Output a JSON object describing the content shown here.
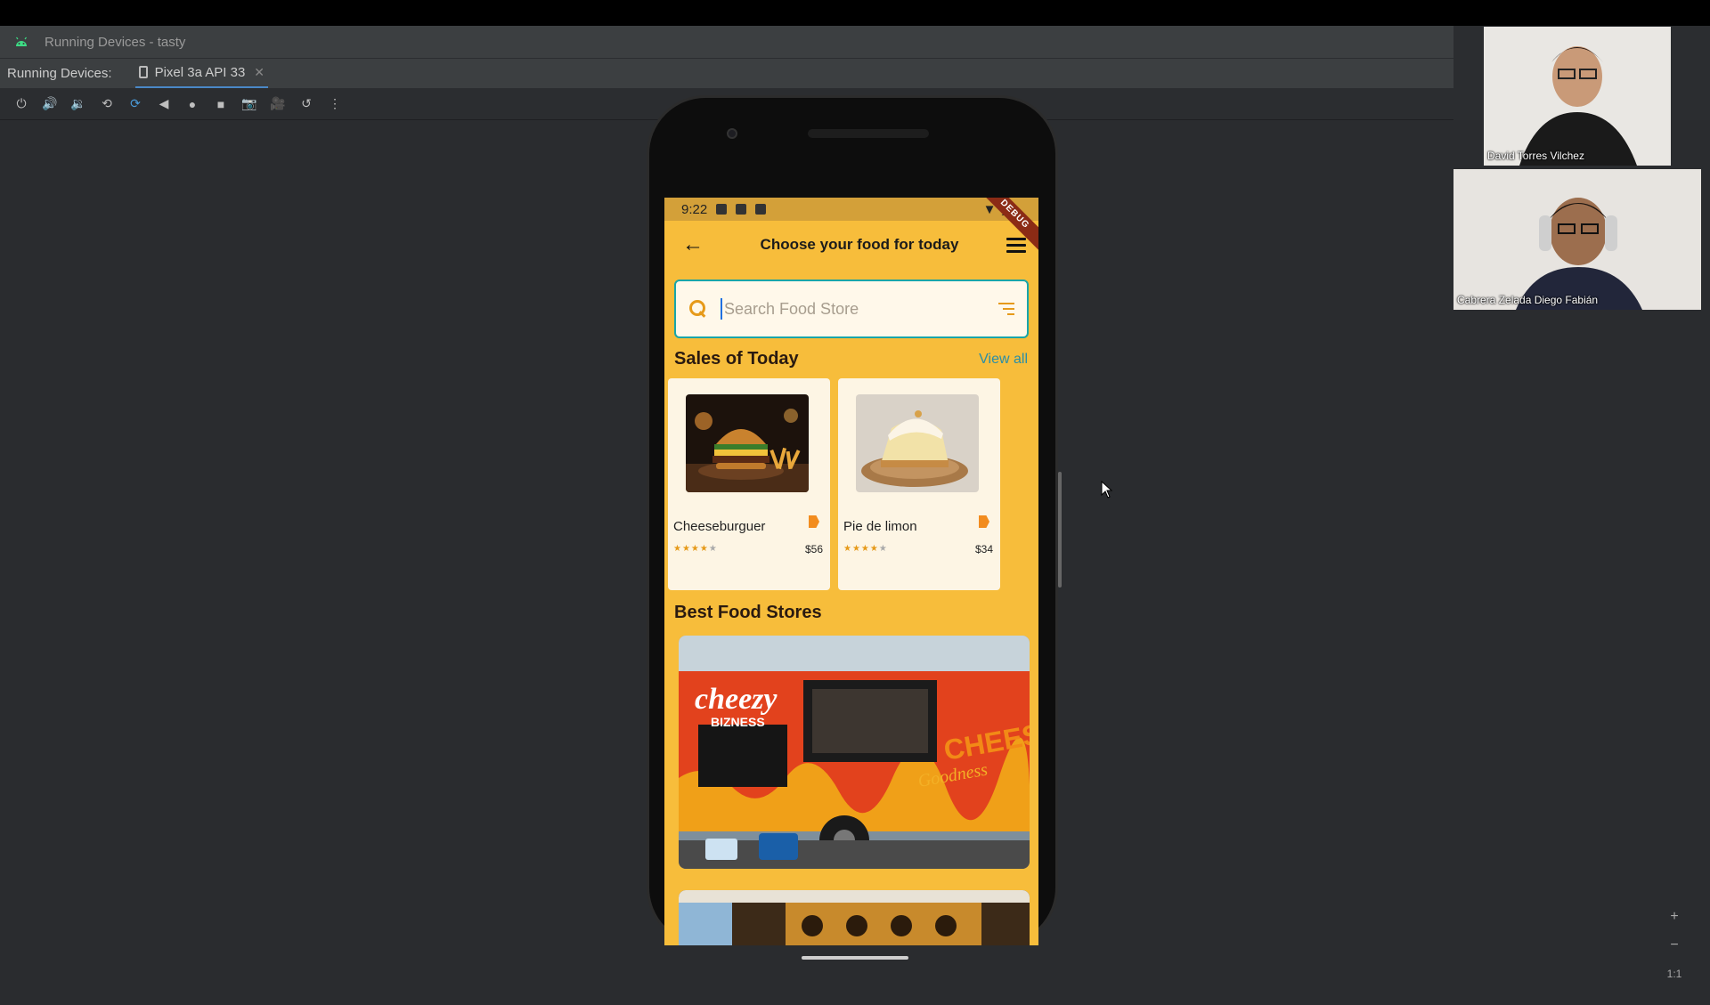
{
  "window": {
    "title": "Running Devices - tasty"
  },
  "tabbar": {
    "label": "Running Devices:",
    "tab_label": "Pixel 3a API 33"
  },
  "toolbar": {
    "buttons": [
      "power-icon",
      "volume-up-icon",
      "volume-down-icon",
      "rotate-left-icon",
      "rotate-right-icon",
      "back-icon",
      "home-icon",
      "overview-icon",
      "screenshot-icon",
      "record-icon",
      "reset-icon",
      "more-icon"
    ]
  },
  "phone": {
    "status": {
      "time": "9:22"
    },
    "debug_banner": "DEBUG",
    "appbar": {
      "title": "Choose your food for today"
    },
    "search": {
      "placeholder": "Search Food Store"
    },
    "sales": {
      "heading": "Sales of Today",
      "view_all": "View all",
      "items": [
        {
          "name": "Cheeseburguer",
          "price": "$56",
          "rating": 4
        },
        {
          "name": "Pie de limon",
          "price": "$34",
          "rating": 4
        }
      ]
    },
    "stores": {
      "heading": "Best Food Stores",
      "sign_top": "cheezy",
      "sign_sub": "BIZNESS",
      "side_text_1": "CHEESE",
      "side_text_2": "Goodness"
    }
  },
  "participants": [
    {
      "name": "David Torres Vilchez"
    },
    {
      "name": "Cabrera Zelada Diego Fabián"
    }
  ],
  "zoom": {
    "plus": "+",
    "minus": "−",
    "ratio": "1:1"
  },
  "colors": {
    "app_bg": "#f7bd3b",
    "accent": "#18a5a9",
    "ide_bg": "#2b2d30"
  }
}
